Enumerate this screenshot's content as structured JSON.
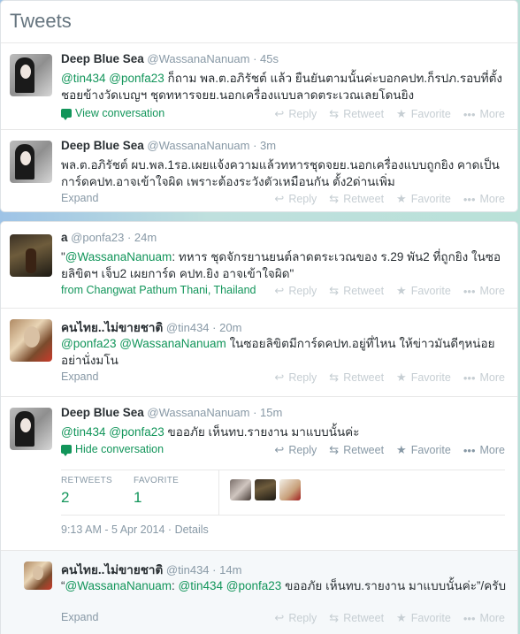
{
  "panel_title": "Tweets",
  "actions": {
    "reply": "Reply",
    "retweet": "Retweet",
    "favorite": "Favorite",
    "more": "More"
  },
  "tweets": [
    {
      "name": "Deep Blue Sea",
      "handle": "@WassanaNanuam",
      "time": "45s",
      "mention1": "@tin434",
      "mention2": "@ponfa23",
      "text": "ก็ถาม พล.ต.อภิรัชต์ แล้ว ยืนยันตามนั้นค่ะบอกคปท.ก็รปภ.รอบที่ตั้ง ชอยข้างวัดเบญฯ ชุดทหารจยย.นอกเครื่องแบบลาดตระเวณเลยโดนยิง",
      "link": "View conversation"
    },
    {
      "name": "Deep Blue Sea",
      "handle": "@WassanaNanuam",
      "time": "3m",
      "text": "พล.ต.อภิรัชต์ ผบ.พล.1รอ.เผยแจ้งความแล้วทหารชุดจยย.นอกเครื่องแบบถูกยิง คาดเป็นการ์ดคปท.อาจเข้าใจผิด เพราะต้องระวังตัวเหมือนกัน ตั้ง2ด่านเพิ่ม",
      "link": "Expand"
    },
    {
      "name": "a",
      "handle": "@ponfa23",
      "time": "24m",
      "quote_open": "\"",
      "mention1": "@WassanaNanuam",
      "text": ": ทหาร ชุดจักรยานยนต์ลาดตระเวณของ ร.29 พัน2 ที่ถูกยิง ในซอยลิขิตฯ เจ็บ2 เผยการ์ด คปท.ยิง อาจเข้าใจผิด\"",
      "link": "from Changwat Pathum Thani, Thailand"
    },
    {
      "name": "คนไทย..ไม่ขายชาติ",
      "handle": "@tin434",
      "time": "20m",
      "mention1": "@ponfa23",
      "mention2": "@WassanaNanuam",
      "text": "ในซอยลิขิตมีการ์ดคปท.อยู่ที่ไหน ให้ข่าวมันดีๆหน่อยอย่านั่งมโน",
      "link": "Expand"
    },
    {
      "name": "Deep Blue Sea",
      "handle": "@WassanaNanuam",
      "time": "15m",
      "mention1": "@tin434",
      "mention2": "@ponfa23",
      "text": "ขออภัย เห็นทบ.รายงาน มาแบบนั้นค่ะ",
      "link": "Hide conversation",
      "stats": {
        "retweets_label": "RETWEETS",
        "retweets": "2",
        "favorite_label": "FAVORITE",
        "favorite": "1"
      },
      "datetime": "9:13 AM - 5 Apr 2014",
      "details": "Details"
    },
    {
      "name": "คนไทย..ไม่ขายชาติ",
      "handle": "@tin434",
      "time": "14m",
      "quote_open": "“",
      "mention1": "@WassanaNanuam",
      "mention2": "@tin434",
      "mention3": "@ponfa23",
      "text": "ขออภัย เห็นทบ.รายงาน มาแบบนั้นค่ะ”/ครับ",
      "link": "Expand"
    }
  ],
  "icons": {
    "conversation": "speech-bubble-icon",
    "reply": "reply-arrow-icon",
    "retweet": "retweet-icon",
    "favorite": "star-icon",
    "more": "dots-icon"
  }
}
